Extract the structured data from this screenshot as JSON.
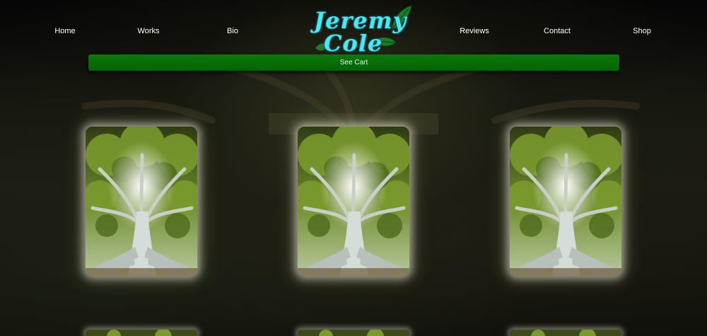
{
  "nav": {
    "links": [
      "Home",
      "Works",
      "Bio",
      "Reviews",
      "Contact",
      "Shop"
    ]
  },
  "logo": {
    "line1": "Jeremy",
    "line2": "Cole"
  },
  "cart": {
    "label": "See Cart"
  },
  "colors": {
    "logo_text": "#4ee4f0",
    "cart_bar": "#067206",
    "leaf": "#1e7a2a"
  },
  "products": {
    "row1": [
      "tree-image",
      "tree-image",
      "tree-image"
    ],
    "row2": [
      "tree-image",
      "tree-image",
      "tree-image"
    ]
  }
}
